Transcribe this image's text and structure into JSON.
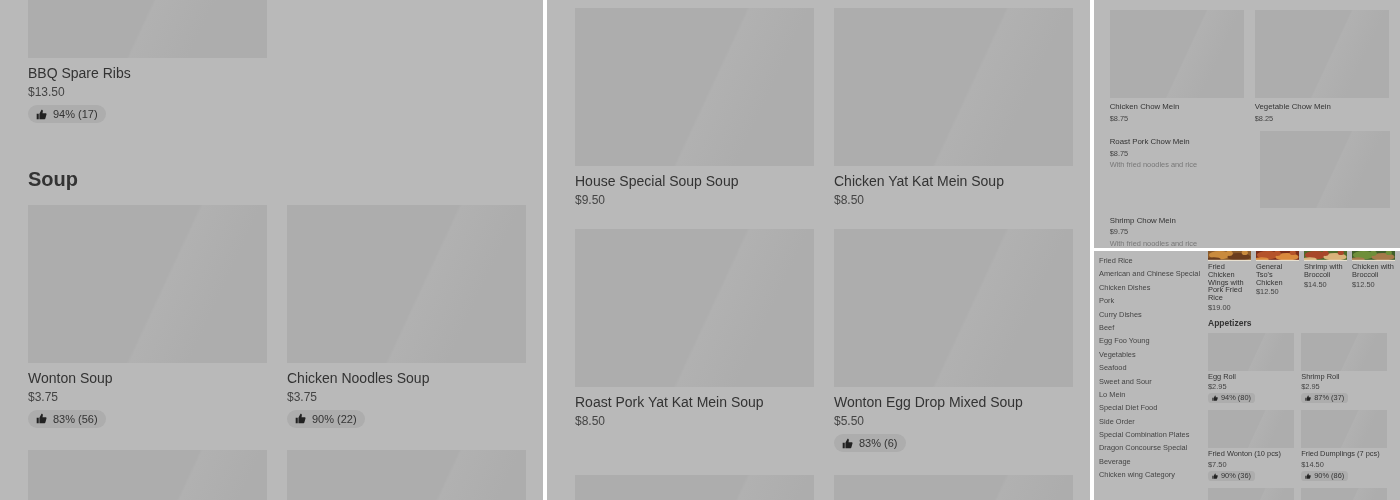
{
  "panels": [
    {
      "kind": "menu",
      "blocks": [
        {
          "kind": "cards",
          "cards": [
            {
              "kind": "card",
              "name": "BBQ Spare Ribs",
              "price": "$13.50",
              "rating": "94% (17)"
            }
          ]
        },
        {
          "kind": "heading",
          "text": "Soup"
        },
        {
          "kind": "cards",
          "cards": [
            {
              "kind": "card",
              "name": "Wonton Soup",
              "price": "$3.75",
              "rating": "83% (56)"
            },
            {
              "kind": "card",
              "name": "Chicken Noodles Soup",
              "price": "$3.75",
              "rating": "90% (22)"
            }
          ]
        },
        {
          "kind": "cards",
          "cards": [
            {
              "kind": "image-only"
            },
            {
              "kind": "image-only"
            }
          ]
        }
      ]
    },
    {
      "kind": "menu",
      "blocks": [
        {
          "kind": "cards",
          "cards": [
            {
              "kind": "card",
              "name": "House Special Soup Soup",
              "price": "$9.50"
            },
            {
              "kind": "card",
              "name": "Chicken Yat Kat Mein Soup",
              "price": "$8.50"
            }
          ]
        },
        {
          "kind": "cards",
          "cards": [
            {
              "kind": "card",
              "name": "Roast Pork Yat Kat Mein Soup",
              "price": "$8.50"
            },
            {
              "kind": "card",
              "name": "Wonton Egg Drop Mixed Soup",
              "price": "$5.50",
              "rating": "83% (6)"
            }
          ]
        },
        {
          "kind": "cards",
          "cards": [
            {
              "kind": "image-only"
            },
            {
              "kind": "image-only"
            }
          ]
        }
      ]
    },
    {
      "kind": "menu",
      "blocks": [
        {
          "kind": "cards",
          "cards": [
            {
              "kind": "card",
              "name": "Chicken Chow Mein",
              "price": "$8.75"
            },
            {
              "kind": "card",
              "name": "Vegetable Chow Mein",
              "price": "$8.25"
            }
          ]
        },
        {
          "kind": "side-item",
          "name": "Roast Pork Chow Mein",
          "price": "$8.75",
          "description": "With fried noodles and rice"
        },
        {
          "kind": "text-item",
          "name": "Shrimp Chow Mein",
          "price": "$9.75",
          "description": "With fried noodles and rice"
        }
      ]
    },
    {
      "kind": "sidebar-menu",
      "sidebar": [
        "Fried Rice",
        "American and Chinese Special",
        "Chicken Dishes",
        "Pork",
        "Curry Dishes",
        "Beef",
        "Egg Foo Young",
        "Vegetables",
        "Seafood",
        "Sweet and Sour",
        "Lo Mein",
        "Special Diet Food",
        "Side Order",
        "Special Combination Plates",
        "Dragon Concourse Special",
        "Beverage",
        "Chicken wing Category"
      ],
      "blocks": [
        {
          "kind": "photo-cards",
          "cards": [
            {
              "name": "Fried Chicken Wings with Pork Fried Rice",
              "price": "$19.00"
            },
            {
              "name": "General Tso's Chicken",
              "price": "$12.50"
            },
            {
              "name": "Shrimp with Broccoli",
              "price": "$14.50"
            },
            {
              "name": "Chicken with Broccoli",
              "price": "$12.50"
            }
          ]
        },
        {
          "kind": "heading",
          "text": "Appetizers"
        },
        {
          "kind": "cards",
          "cards": [
            {
              "kind": "card",
              "name": "Egg Roll",
              "price": "$2.95",
              "rating": "94% (80)"
            },
            {
              "kind": "card",
              "name": "Shrimp Roll",
              "price": "$2.95",
              "rating": "87% (37)"
            }
          ]
        },
        {
          "kind": "cards",
          "cards": [
            {
              "kind": "card",
              "name": "Fried Wonton (10 pcs)",
              "price": "$7.50",
              "rating": "90% (36)"
            },
            {
              "kind": "card",
              "name": "Fried Dumplings (7 pcs)",
              "price": "$14.50",
              "rating": "90% (86)"
            }
          ]
        },
        {
          "kind": "cards",
          "cards": [
            {
              "kind": "image-only"
            },
            {
              "kind": "image-only"
            }
          ]
        }
      ]
    }
  ]
}
